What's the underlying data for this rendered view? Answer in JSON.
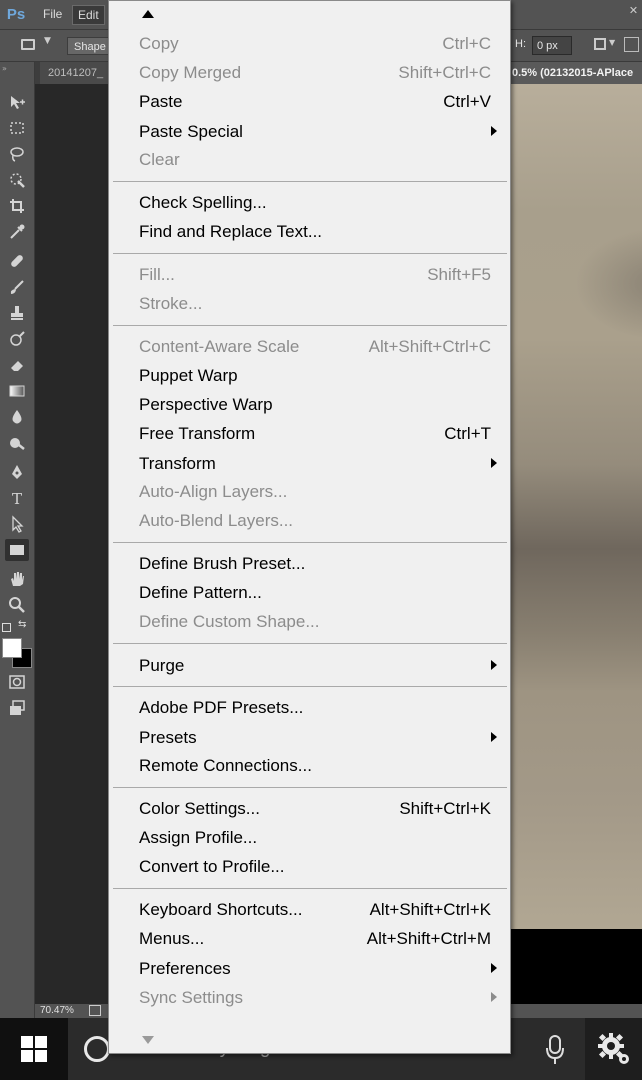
{
  "app": {
    "logo": "Ps",
    "menubar": [
      "File",
      "Edit"
    ]
  },
  "options_bar": {
    "tool_mode": "Shape",
    "height_label": "H:",
    "height_value": "0 px"
  },
  "document": {
    "tab_left": "20141207_",
    "tab_right": "0.5% (02132015-APlace",
    "zoom": "70.47%"
  },
  "edit_menu": {
    "items": [
      {
        "label": "Copy",
        "shortcut": "Ctrl+C",
        "enabled": false,
        "submenu": false
      },
      {
        "label": "Copy Merged",
        "shortcut": "Shift+Ctrl+C",
        "enabled": false,
        "submenu": false
      },
      {
        "label": "Paste",
        "shortcut": "Ctrl+V",
        "enabled": true,
        "submenu": false
      },
      {
        "label": "Paste Special",
        "shortcut": "",
        "enabled": true,
        "submenu": true
      },
      {
        "label": "Clear",
        "shortcut": "",
        "enabled": false,
        "submenu": false
      },
      {
        "label": "Check Spelling...",
        "shortcut": "",
        "enabled": true,
        "submenu": false
      },
      {
        "label": "Find and Replace Text...",
        "shortcut": "",
        "enabled": true,
        "submenu": false
      },
      {
        "label": "Fill...",
        "shortcut": "Shift+F5",
        "enabled": false,
        "submenu": false
      },
      {
        "label": "Stroke...",
        "shortcut": "",
        "enabled": false,
        "submenu": false
      },
      {
        "label": "Content-Aware Scale",
        "shortcut": "Alt+Shift+Ctrl+C",
        "enabled": false,
        "submenu": false
      },
      {
        "label": "Puppet Warp",
        "shortcut": "",
        "enabled": true,
        "submenu": false
      },
      {
        "label": "Perspective Warp",
        "shortcut": "",
        "enabled": true,
        "submenu": false
      },
      {
        "label": "Free Transform",
        "shortcut": "Ctrl+T",
        "enabled": true,
        "submenu": false
      },
      {
        "label": "Transform",
        "shortcut": "",
        "enabled": true,
        "submenu": true
      },
      {
        "label": "Auto-Align Layers...",
        "shortcut": "",
        "enabled": false,
        "submenu": false
      },
      {
        "label": "Auto-Blend Layers...",
        "shortcut": "",
        "enabled": false,
        "submenu": false
      },
      {
        "label": "Define Brush Preset...",
        "shortcut": "",
        "enabled": true,
        "submenu": false
      },
      {
        "label": "Define Pattern...",
        "shortcut": "",
        "enabled": true,
        "submenu": false
      },
      {
        "label": "Define Custom Shape...",
        "shortcut": "",
        "enabled": false,
        "submenu": false
      },
      {
        "label": "Purge",
        "shortcut": "",
        "enabled": true,
        "submenu": true
      },
      {
        "label": "Adobe PDF Presets...",
        "shortcut": "",
        "enabled": true,
        "submenu": false
      },
      {
        "label": "Presets",
        "shortcut": "",
        "enabled": true,
        "submenu": true
      },
      {
        "label": "Remote Connections...",
        "shortcut": "",
        "enabled": true,
        "submenu": false
      },
      {
        "label": "Color Settings...",
        "shortcut": "Shift+Ctrl+K",
        "enabled": true,
        "submenu": false
      },
      {
        "label": "Assign Profile...",
        "shortcut": "",
        "enabled": true,
        "submenu": false
      },
      {
        "label": "Convert to Profile...",
        "shortcut": "",
        "enabled": true,
        "submenu": false
      },
      {
        "label": "Keyboard Shortcuts...",
        "shortcut": "Alt+Shift+Ctrl+K",
        "enabled": true,
        "submenu": false
      },
      {
        "label": "Menus...",
        "shortcut": "Alt+Shift+Ctrl+M",
        "enabled": true,
        "submenu": false
      },
      {
        "label": "Preferences",
        "shortcut": "",
        "enabled": true,
        "submenu": true
      },
      {
        "label": "Sync Settings",
        "shortcut": "",
        "enabled": false,
        "submenu": true
      }
    ]
  },
  "taskbar": {
    "search_placeholder": "Ask me anything"
  },
  "colors": {
    "ps_chrome": "#535353",
    "menu_bg": "#f0f0f0",
    "menu_disabled": "#8c8c8c",
    "taskbar": "#101010"
  }
}
